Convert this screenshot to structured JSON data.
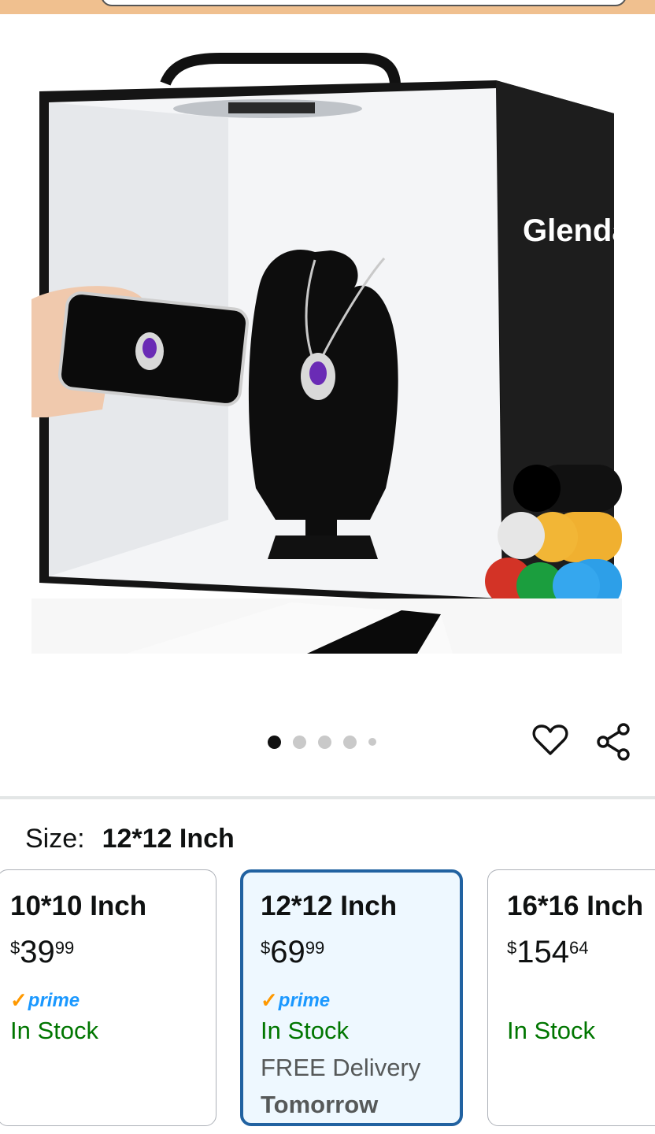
{
  "header": {
    "search_placeholder": ""
  },
  "product": {
    "brand_on_box": "Glendan",
    "image_count": 5,
    "active_image_index": 0
  },
  "actions": {
    "wishlist_icon": "heart-outline-icon",
    "share_icon": "share-icon"
  },
  "size_selector": {
    "label": "Size:",
    "selected_value": "12*12 Inch",
    "options": [
      {
        "size": "10*10 Inch",
        "currency": "$",
        "price_whole": "39",
        "price_fraction": "99",
        "prime": "prime",
        "availability": "In Stock",
        "delivery": "",
        "delivery_day": ""
      },
      {
        "size": "12*12 Inch",
        "currency": "$",
        "price_whole": "69",
        "price_fraction": "99",
        "prime": "prime",
        "availability": "In Stock",
        "delivery": "FREE Delivery",
        "delivery_day": "Tomorrow",
        "selected": true
      },
      {
        "size": "16*16 Inch",
        "currency": "$",
        "price_whole": "154",
        "price_fraction": "64",
        "prime": "",
        "availability": "In Stock",
        "delivery": "",
        "delivery_day": ""
      }
    ]
  },
  "colors": {
    "in_stock": "#007600",
    "prime_blue": "#1a98ff",
    "prime_check": "#ff9900",
    "selected_border": "#2162a1",
    "header_bg": "#f0c08f"
  }
}
